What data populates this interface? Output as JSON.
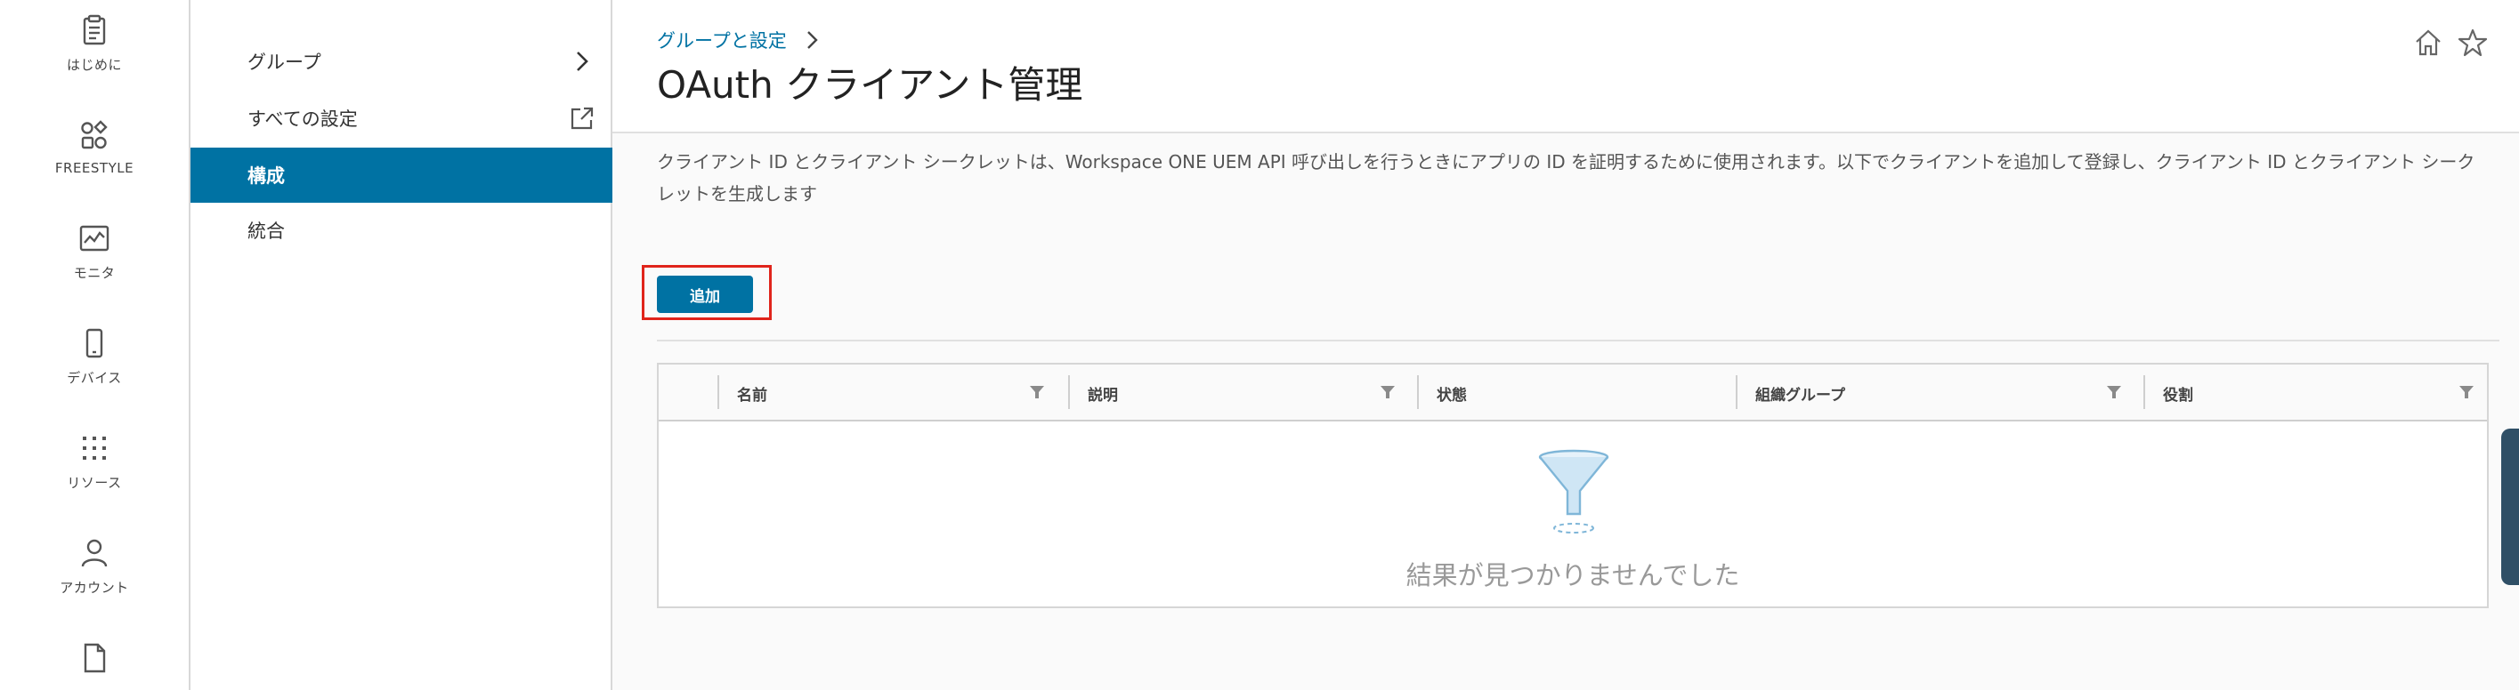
{
  "rail": {
    "items": [
      {
        "label": "はじめに",
        "icon": "clipboard-icon"
      },
      {
        "label": "FREESTYLE",
        "icon": "freestyle-icon"
      },
      {
        "label": "モニタ",
        "icon": "monitor-icon"
      },
      {
        "label": "デバイス",
        "icon": "device-icon"
      },
      {
        "label": "リソース",
        "icon": "resources-icon"
      },
      {
        "label": "アカウント",
        "icon": "account-icon"
      },
      {
        "label": "",
        "icon": "document-icon"
      }
    ]
  },
  "subnav": {
    "items": [
      {
        "label": "グループ",
        "trail": "chevron-right-icon"
      },
      {
        "label": "すべての設定",
        "trail": "external-link-icon"
      },
      {
        "label": "構成",
        "active": true
      },
      {
        "label": "統合"
      }
    ]
  },
  "header": {
    "breadcrumb": "グループと設定",
    "title": "OAuth クライアント管理"
  },
  "description": "クライアント ID とクライアント シークレットは、Workspace ONE UEM API 呼び出しを行うときにアプリの ID を証明するために使用されます。以下でクライアントを追加して登録し、クライアント ID とクライアント シークレットを生成します",
  "toolbar": {
    "add_label": "追加"
  },
  "grid": {
    "columns": [
      "名前",
      "説明",
      "状態",
      "組織グループ",
      "役割"
    ],
    "empty_text": "結果が見つかりませんでした"
  },
  "colors": {
    "accent": "#0072a3",
    "highlight": "#e0241b"
  }
}
